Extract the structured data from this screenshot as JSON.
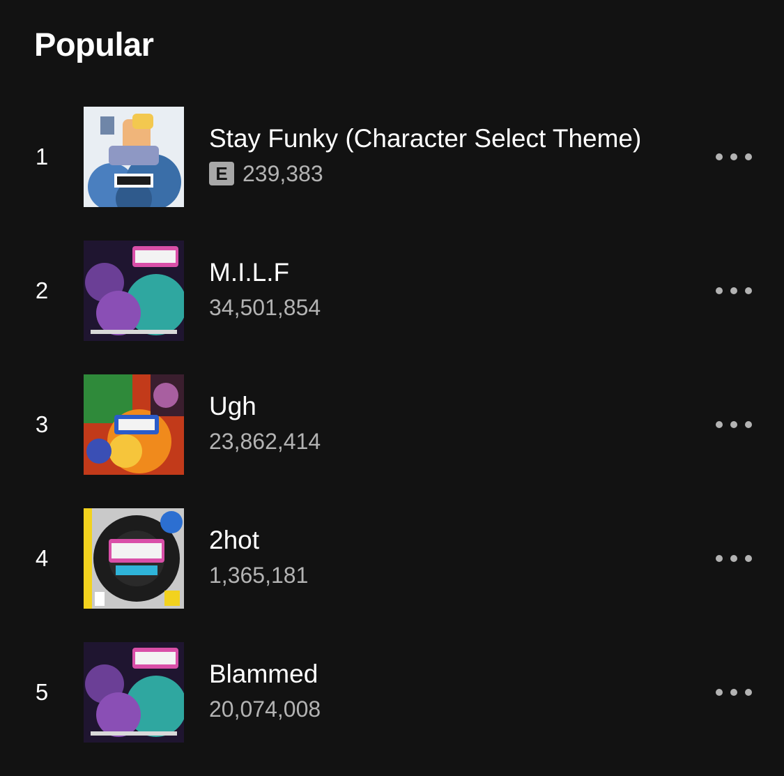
{
  "section": {
    "title": "Popular"
  },
  "tracks": [
    {
      "rank": "1",
      "title": "Stay Funky (Character Select Theme)",
      "explicit": true,
      "explicit_label": "E",
      "plays": "239,383",
      "cover_icon": "album-cover-art"
    },
    {
      "rank": "2",
      "title": "M.I.L.F",
      "explicit": false,
      "explicit_label": "",
      "plays": "34,501,854",
      "cover_icon": "album-cover-art"
    },
    {
      "rank": "3",
      "title": "Ugh",
      "explicit": false,
      "explicit_label": "",
      "plays": "23,862,414",
      "cover_icon": "album-cover-art"
    },
    {
      "rank": "4",
      "title": "2hot",
      "explicit": false,
      "explicit_label": "",
      "plays": "1,365,181",
      "cover_icon": "album-cover-art"
    },
    {
      "rank": "5",
      "title": "Blammed",
      "explicit": false,
      "explicit_label": "",
      "plays": "20,074,008",
      "cover_icon": "album-cover-art"
    }
  ],
  "icons": {
    "more": "more-horizontal-icon"
  },
  "colors": {
    "background": "#121212",
    "primary_text": "#ffffff",
    "secondary_text": "#b3b3b3",
    "explicit_badge": "#a7a7a7"
  }
}
